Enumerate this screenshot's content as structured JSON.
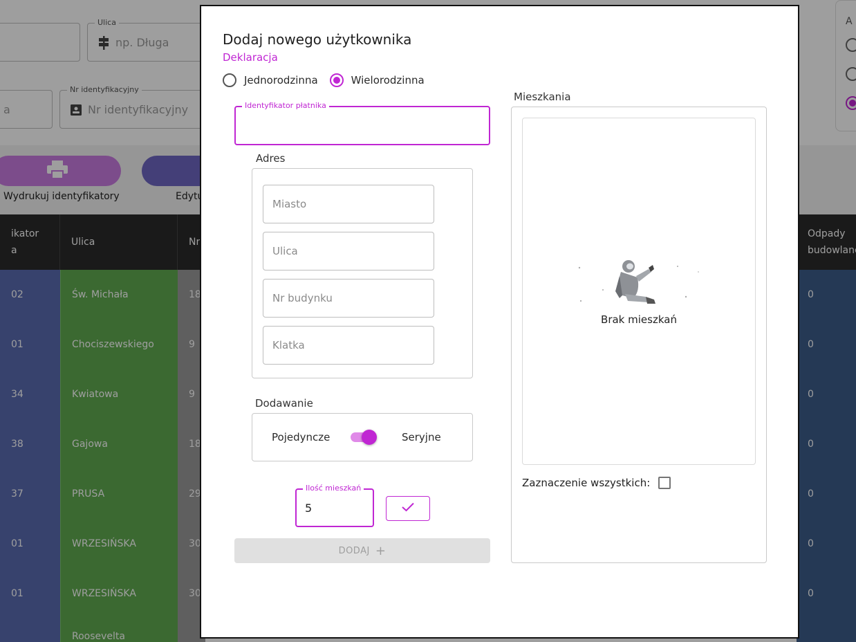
{
  "background": {
    "filters": {
      "street_legend": "Ulica",
      "street_placeholder": "np. Długa",
      "id_legend": "Nr identyfikacyjny",
      "id_placeholder": "Nr identyfikacyjny",
      "left_field_text": "a",
      "right_panel_label": "A"
    },
    "toolbar": {
      "print_label": "Wydrukuj identyfikatory",
      "edit_label": "Edytu"
    },
    "table": {
      "headers": [
        "ikator\na",
        "Ulica",
        "Nr",
        "Odpady\nbudowlane"
      ],
      "id_col": [
        "02",
        "01",
        "34",
        "38",
        "37",
        "01",
        "01"
      ],
      "street_col": [
        "Św. Michała",
        "Chociszewskiego",
        "Kwiatowa",
        "Gajowa",
        "PRUSA",
        "WRZESIŃSKA",
        "WRZESIŃSKA",
        "Roosevelta"
      ],
      "nr_col": [
        "18",
        "9",
        "9",
        "18",
        "29",
        "30",
        "30"
      ],
      "waste_col": [
        "0",
        "0",
        "0",
        "0",
        "0",
        "0",
        "0"
      ],
      "colors": {
        "id_col": "#5a6bb0",
        "street_col": "#5faa4f",
        "head": "#2b2b2b",
        "waste_col": "#3d5c8a"
      }
    }
  },
  "modal": {
    "title": "Dodaj nowego użytkownika",
    "subtitle": "Deklaracja",
    "radio_single": "Jednorodzinna",
    "radio_multi": "Wielorodzinna",
    "selected_radio": "Wielorodzinna",
    "payer_id_label": "Identyfikator płatnika",
    "payer_id_value": "",
    "address_label": "Adres",
    "address_fields": {
      "city": "Miasto",
      "street": "Ulica",
      "building": "Nr budynku",
      "staircase": "Klatka"
    },
    "adding_label": "Dodawanie",
    "mode_single": "Pojedyncze",
    "mode_serial": "Seryjne",
    "serial_enabled": true,
    "count_label": "Ilość mieszkań",
    "count_value": "5",
    "add_button": "DODAJ",
    "apartments_label": "Mieszkania",
    "empty_text": "Brak mieszkań",
    "select_all_label": "Zaznaczenie wszystkich:",
    "accent_color": "#c026d3",
    "icons": [
      "confirm-check-icon",
      "plus-icon",
      "astronaut-empty-icon"
    ]
  }
}
